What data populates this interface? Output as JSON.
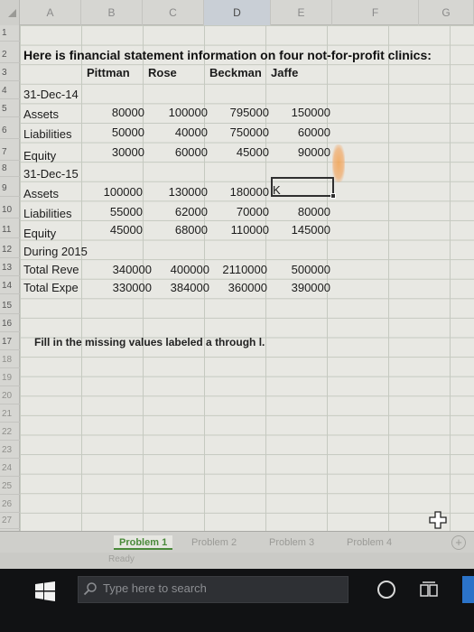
{
  "columns": [
    "A",
    "B",
    "C",
    "D",
    "E",
    "F",
    "G"
  ],
  "rows": [
    "1",
    "2",
    "3",
    "4",
    "5",
    "6",
    "7",
    "8",
    "9",
    "10",
    "11",
    "12",
    "13",
    "14",
    "15",
    "16",
    "17",
    "18",
    "19",
    "20",
    "21",
    "22",
    "23",
    "24",
    "25",
    "26",
    "27"
  ],
  "sheet": {
    "title": "Here is financial statement information on four not-for-profit clinics:",
    "clinics": [
      "Pittman",
      "Rose",
      "Beckman",
      "Jaffe"
    ],
    "date_2014": "31-Dec-14",
    "date_2015": "31-Dec-15",
    "during_2015": "During 2015",
    "labels": {
      "assets": "Assets",
      "liabilities": "Liabilities",
      "equity": "Equity",
      "total_revenue": "Total Reve",
      "total_expense": "Total Expe"
    },
    "y2014": {
      "assets": [
        "80000",
        "100000",
        "795000",
        "150000"
      ],
      "liabilities": [
        "50000",
        "40000",
        "750000",
        "60000"
      ],
      "equity": [
        "30000",
        "60000",
        "45000",
        "90000"
      ]
    },
    "y2015": {
      "assets": [
        "100000",
        "130000",
        "180000",
        "K"
      ],
      "liabilities": [
        "55000",
        "62000",
        "70000",
        "80000"
      ],
      "equity": [
        "45000",
        "68000",
        "110000",
        "145000"
      ]
    },
    "during": {
      "total_revenue": [
        "340000",
        "400000",
        "2110000",
        "500000"
      ],
      "total_expense": [
        "330000",
        "384000",
        "360000",
        "390000"
      ]
    },
    "note": "Fill in the missing values labeled a through l."
  },
  "tabs": [
    "Problem 1",
    "Problem 2",
    "Problem 3",
    "Problem 4"
  ],
  "status": "Ready",
  "taskbar": {
    "search_placeholder": "Type here to search"
  },
  "colors": {
    "active_tab": "#4a8a3a",
    "sheet_bg": "#e8e8e3",
    "taskbar_bg": "#111214"
  }
}
